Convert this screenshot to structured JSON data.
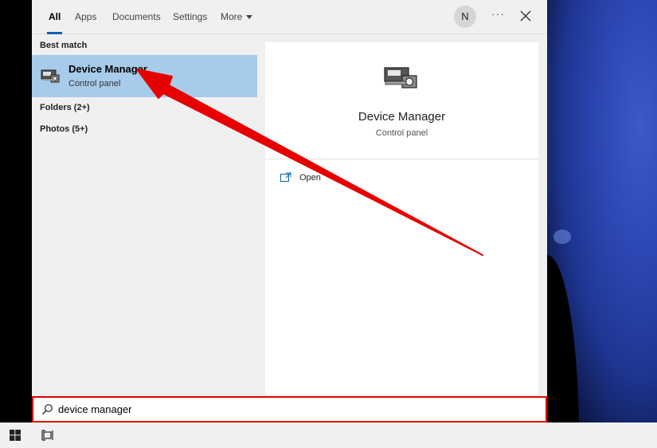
{
  "tabs": [
    {
      "label": "All",
      "active": true
    },
    {
      "label": "Apps",
      "active": false
    },
    {
      "label": "Documents",
      "active": false
    },
    {
      "label": "Settings",
      "active": false
    },
    {
      "label": "More",
      "active": false
    }
  ],
  "user": {
    "initial": "N"
  },
  "header": {
    "more_options": "···"
  },
  "best_match": {
    "heading": "Best match",
    "title": "Device Manager",
    "subtitle": "Control panel"
  },
  "groups": [
    {
      "label": "Folders (2+)"
    },
    {
      "label": "Photos (5+)"
    }
  ],
  "detail": {
    "title": "Device Manager",
    "subtitle": "Control panel",
    "actions": [
      {
        "label": "Open",
        "icon": "open-icon"
      }
    ]
  },
  "search": {
    "value": "device manager"
  },
  "colors": {
    "selection": "#a7cbea",
    "accent": "#0063b1",
    "annotation": "#e60000"
  }
}
